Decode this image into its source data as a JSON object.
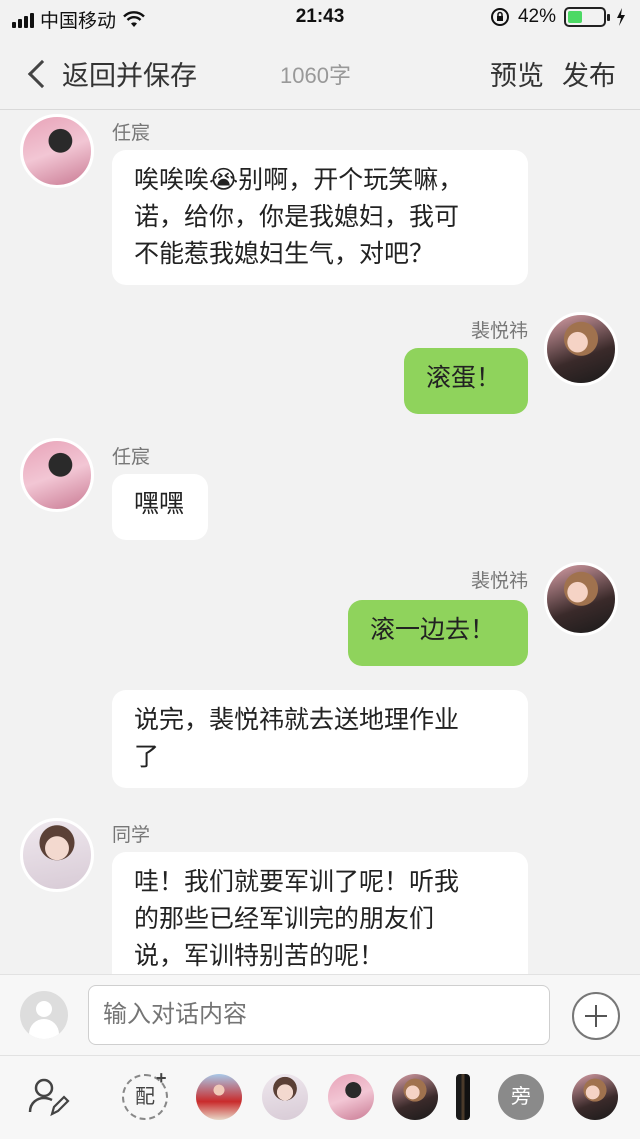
{
  "status_bar": {
    "carrier": "中国移动",
    "time": "21:43",
    "battery_percent": "42%",
    "battery_level": 0.42,
    "icons": [
      "signal-icon",
      "wifi-icon",
      "orientation-lock-icon",
      "battery-icon",
      "charging-icon"
    ]
  },
  "nav": {
    "back_label": "返回并保存",
    "word_count": "1060字",
    "preview_label": "预览",
    "publish_label": "发布"
  },
  "messages": [
    {
      "sender": "任宸",
      "side": "left",
      "text_lines": [
        "唉唉唉😭别啊，开个玩笑嘛，",
        "诺，给你，你是我媳妇，我可",
        "不能惹我媳妇生气，对吧？"
      ]
    },
    {
      "sender": "裴悦祎",
      "side": "right",
      "text": "滚蛋！"
    },
    {
      "sender": "任宸",
      "side": "left",
      "text": "嘿嘿"
    },
    {
      "sender": "裴悦祎",
      "side": "right",
      "text": "滚一边去！"
    },
    {
      "sender": "",
      "side": "narration",
      "text_lines": [
        "说完，裴悦祎就去送地理作业",
        "了"
      ]
    },
    {
      "sender": "同学",
      "side": "left",
      "text_lines": [
        "哇！我们就要军训了呢！听我",
        "的那些已经军训完的朋友们",
        "说，军训特别苦的呢！"
      ]
    }
  ],
  "input": {
    "placeholder": "输入对话内容"
  },
  "toolbar": {
    "pei_label": "配",
    "pei_plus": "+",
    "pang_label": "旁"
  },
  "colors": {
    "background": "#f2f2f2",
    "own_bubble": "#8fd35c",
    "other_bubble": "#ffffff",
    "battery_fill": "#4cd964"
  }
}
